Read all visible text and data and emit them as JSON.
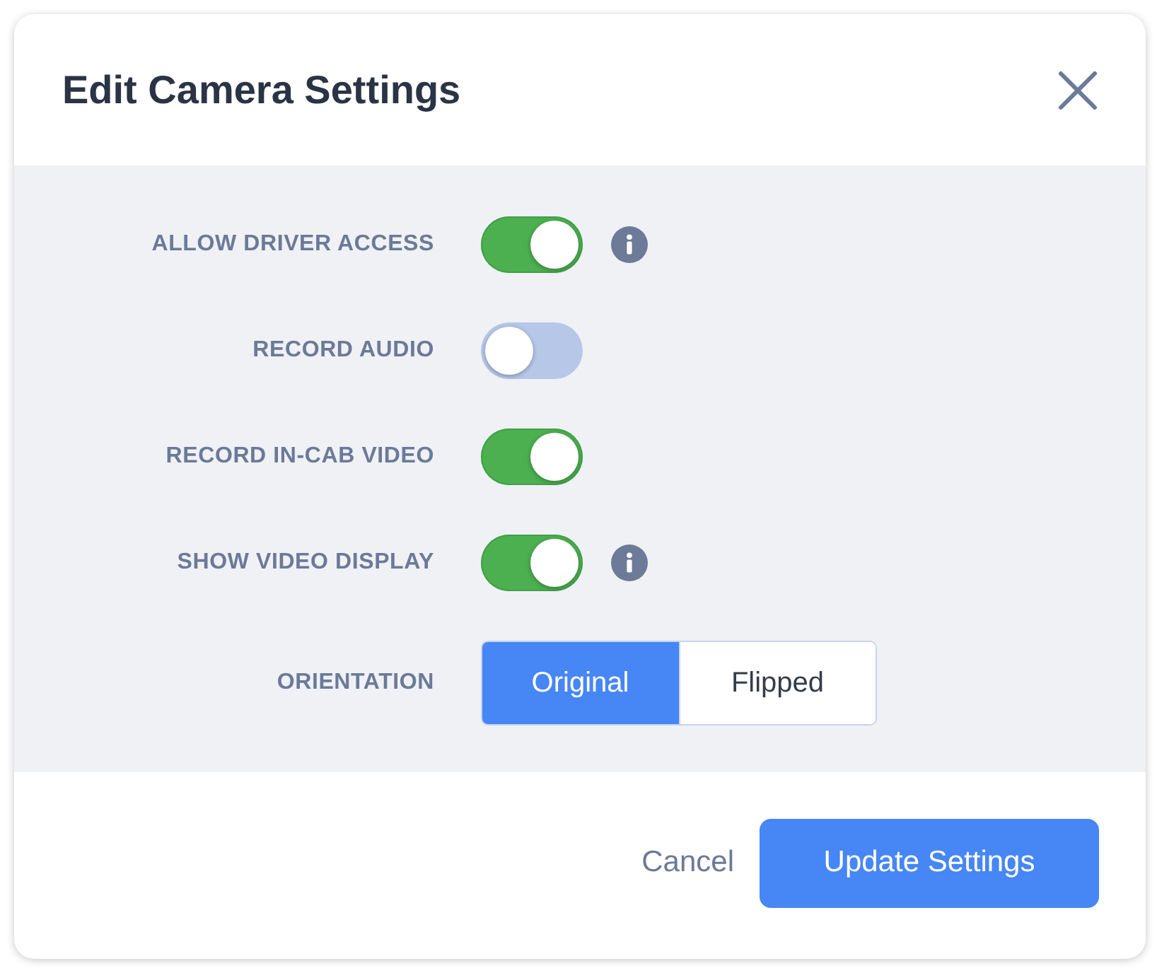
{
  "dialog": {
    "title": "Edit Camera Settings"
  },
  "settings": [
    {
      "kind": "toggle",
      "label": "ALLOW DRIVER ACCESS",
      "on": true,
      "info": true
    },
    {
      "kind": "toggle",
      "label": "RECORD AUDIO",
      "on": false,
      "info": false
    },
    {
      "kind": "toggle",
      "label": "RECORD IN-CAB VIDEO",
      "on": true,
      "info": false
    },
    {
      "kind": "toggle",
      "label": "SHOW VIDEO DISPLAY",
      "on": true,
      "info": true
    },
    {
      "kind": "segmented",
      "label": "ORIENTATION",
      "options": [
        {
          "label": "Original",
          "selected": true
        },
        {
          "label": "Flipped",
          "selected": false
        }
      ]
    }
  ],
  "footer": {
    "buttons": [
      {
        "kind": "link",
        "label": "Cancel"
      },
      {
        "kind": "primary",
        "label": "Update Settings"
      }
    ]
  }
}
